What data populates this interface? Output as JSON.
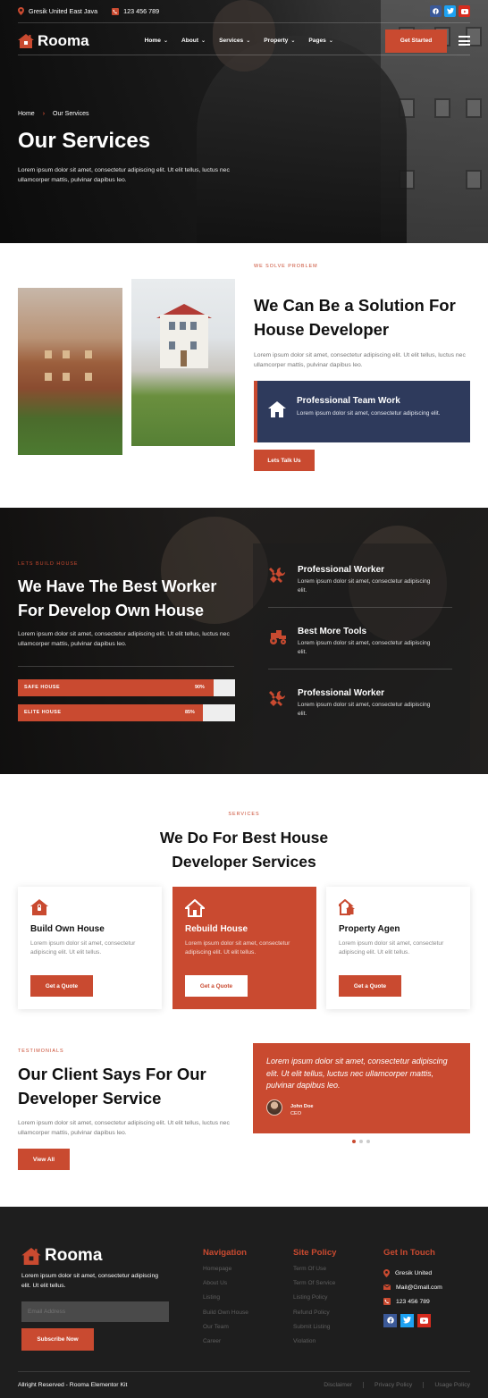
{
  "topbar": {
    "location": "Gresik United East Java",
    "phone": "123 456 789",
    "social": [
      "facebook-icon",
      "twitter-icon",
      "youtube-icon"
    ]
  },
  "nav": {
    "brand": "Rooma",
    "items": [
      {
        "label": "Home"
      },
      {
        "label": "About"
      },
      {
        "label": "Services"
      },
      {
        "label": "Property"
      },
      {
        "label": "Pages"
      }
    ],
    "cta": "Get Started"
  },
  "hero": {
    "breadcrumb_home": "Home",
    "breadcrumb_sep": "›",
    "breadcrumb_current": "Our Services",
    "title": "Our Services",
    "text": "Lorem ipsum dolor sit amet, consectetur adipiscing elit. Ut elit tellus, luctus nec ullamcorper mattis, pulvinar dapibus leo."
  },
  "solution": {
    "tag": "We Solve Problem",
    "title": "We Can Be a Solution For House Developer",
    "text": "Lorem ipsum dolor sit amet, consectetur adipiscing elit. Ut elit tellus, luctus nec ullamcorper mattis, pulvinar dapibus leo.",
    "feature_title": "Professional Team Work",
    "feature_text": "Lorem ipsum dolor sit amet, consectetur adipiscing elit.",
    "button": "Lets Talk Us"
  },
  "worker": {
    "tag": "Lets Build House",
    "title": "We Have The Best Worker For Develop Own House",
    "text": "Lorem ipsum dolor sit amet, consectetur adipiscing elit. Ut elit tellus, luctus nec ullamcorper mattis, pulvinar dapibus leo.",
    "skills": [
      {
        "label": "SAFE HOUSE",
        "value": "90%",
        "fraction": 0.9
      },
      {
        "label": "ELITE HOUSE",
        "value": "85%",
        "fraction": 0.85
      }
    ],
    "features": [
      {
        "title": "Professional Worker",
        "text": "Lorem ipsum dolor sit amet, consectetur adipiscing elit.",
        "icon": "tools-icon"
      },
      {
        "title": "Best More Tools",
        "text": "Lorem ipsum dolor sit amet, consectetur adipiscing elit.",
        "icon": "tractor-icon"
      },
      {
        "title": "Professional Worker",
        "text": "Lorem ipsum dolor sit amet, consectetur adipiscing elit.",
        "icon": "tools-icon"
      }
    ]
  },
  "services": {
    "tag": "Services",
    "title": "We Do For Best House Developer Services",
    "cards": [
      {
        "title": "Build Own House",
        "text": "Lorem ipsum dolor sit amet, consectetur adipiscing elit. Ut elit tellus.",
        "button": "Get a Quote",
        "icon": "house-lock-icon"
      },
      {
        "title": "Rebuild House",
        "text": "Lorem ipsum dolor sit amet, consectetur adipiscing elit. Ut elit tellus.",
        "button": "Get a Quote",
        "icon": "home-outline-icon"
      },
      {
        "title": "Property Agen",
        "text": "Lorem ipsum dolor sit amet, consectetur adipiscing elit. Ut elit tellus.",
        "button": "Get a Quote",
        "icon": "houses-icon"
      }
    ]
  },
  "testimonials": {
    "tag": "Testimonials",
    "title": "Our Client Says For Our Developer Service",
    "text": "Lorem ipsum dolor sit amet, consectetur adipiscing elit. Ut elit tellus, luctus nec ullamcorper mattis, pulvinar dapibus leo.",
    "button": "View All",
    "quote": "Lorem ipsum dolor sit amet, consectetur adipiscing elit. Ut elit tellus, luctus nec ullamcorper mattis, pulvinar dapibus leo.",
    "author": "John Doe",
    "role": "CEO"
  },
  "footer": {
    "brand": "Rooma",
    "about": "Lorem ipsum dolor sit amet, consectetur adipiscing elit. Ut elit tellus.",
    "email_placeholder": "Email Address",
    "subscribe": "Subscribe Now",
    "nav_title": "Navigation",
    "nav_links": [
      "Homepage",
      "About Us",
      "Listing",
      "Build Own House",
      "Our Team",
      "Career"
    ],
    "policy_title": "Site Policy",
    "policy_links": [
      "Term Of Use",
      "Term Of Service",
      "Listing Policy",
      "Refund Policy",
      "Submit Listing",
      "Violation"
    ],
    "contact_title": "Get In Touch",
    "contact_location": "Gresik United",
    "contact_email": "Mail@Gmall.com",
    "contact_phone": "123 456 789",
    "copyright": "Allright Reserved - Rooma Elementor Kit",
    "legal": [
      "Disclaimer",
      "Privacy Policy",
      "Usage Policy"
    ]
  },
  "colors": {
    "accent": "#c94a30",
    "navy": "#2e3a5c",
    "footer_bg": "#1e1e1e",
    "facebook": "#3b5998",
    "twitter": "#1da1f2",
    "youtube": "#d52b1e"
  }
}
